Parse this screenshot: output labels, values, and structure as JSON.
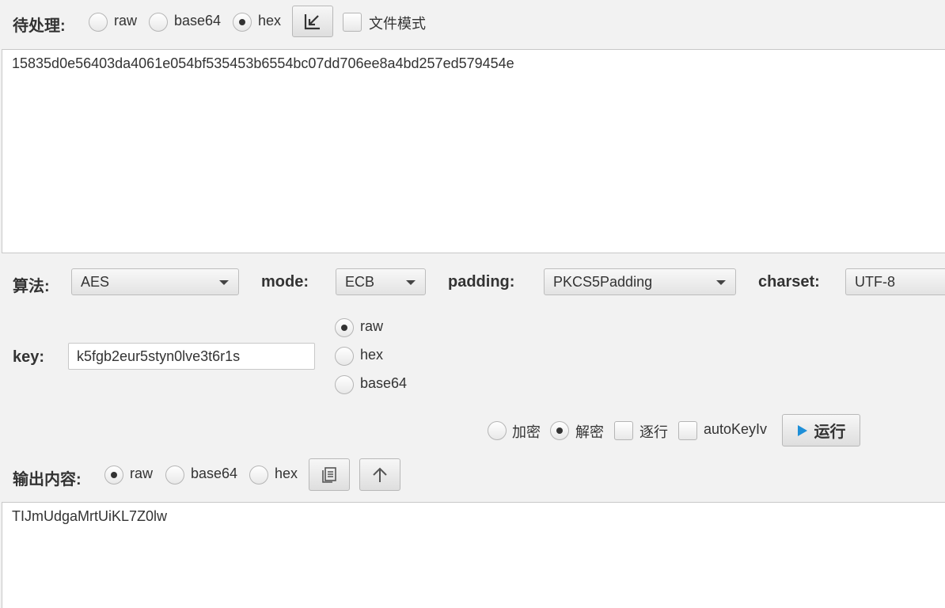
{
  "input_section": {
    "label": "待处理:",
    "formats": [
      "raw",
      "base64",
      "hex"
    ],
    "selected_format": "hex",
    "import_icon": "arrow-down-left-icon",
    "file_mode_label": "文件模式",
    "file_mode_checked": false,
    "text": "15835d0e56403da4061e054bf535453b6554bc07dd706ee8a4bd257ed579454e"
  },
  "config": {
    "algorithm_label": "算法:",
    "algorithm_value": "AES",
    "mode_label": "mode:",
    "mode_value": "ECB",
    "padding_label": "padding:",
    "padding_value": "PKCS5Padding",
    "charset_label": "charset:",
    "charset_value": "UTF-8"
  },
  "key_section": {
    "label": "key:",
    "value": "k5fgb2eur5styn0lve3t6r1s",
    "formats": [
      "raw",
      "hex",
      "base64"
    ],
    "selected_format": "raw"
  },
  "actions": {
    "encrypt_label": "加密",
    "decrypt_label": "解密",
    "selected": "decrypt",
    "line_by_line_label": "逐行",
    "autokeyiv_label": "autoKeyIv",
    "run_label": "运行",
    "run_icon": "play-icon"
  },
  "output_section": {
    "label": "输出内容:",
    "formats": [
      "raw",
      "base64",
      "hex"
    ],
    "selected_format": "raw",
    "copy_icon": "copy-icon",
    "move_up_icon": "arrow-up-icon",
    "text": "TIJmUdgaMrtUiKL7Z0lw"
  }
}
